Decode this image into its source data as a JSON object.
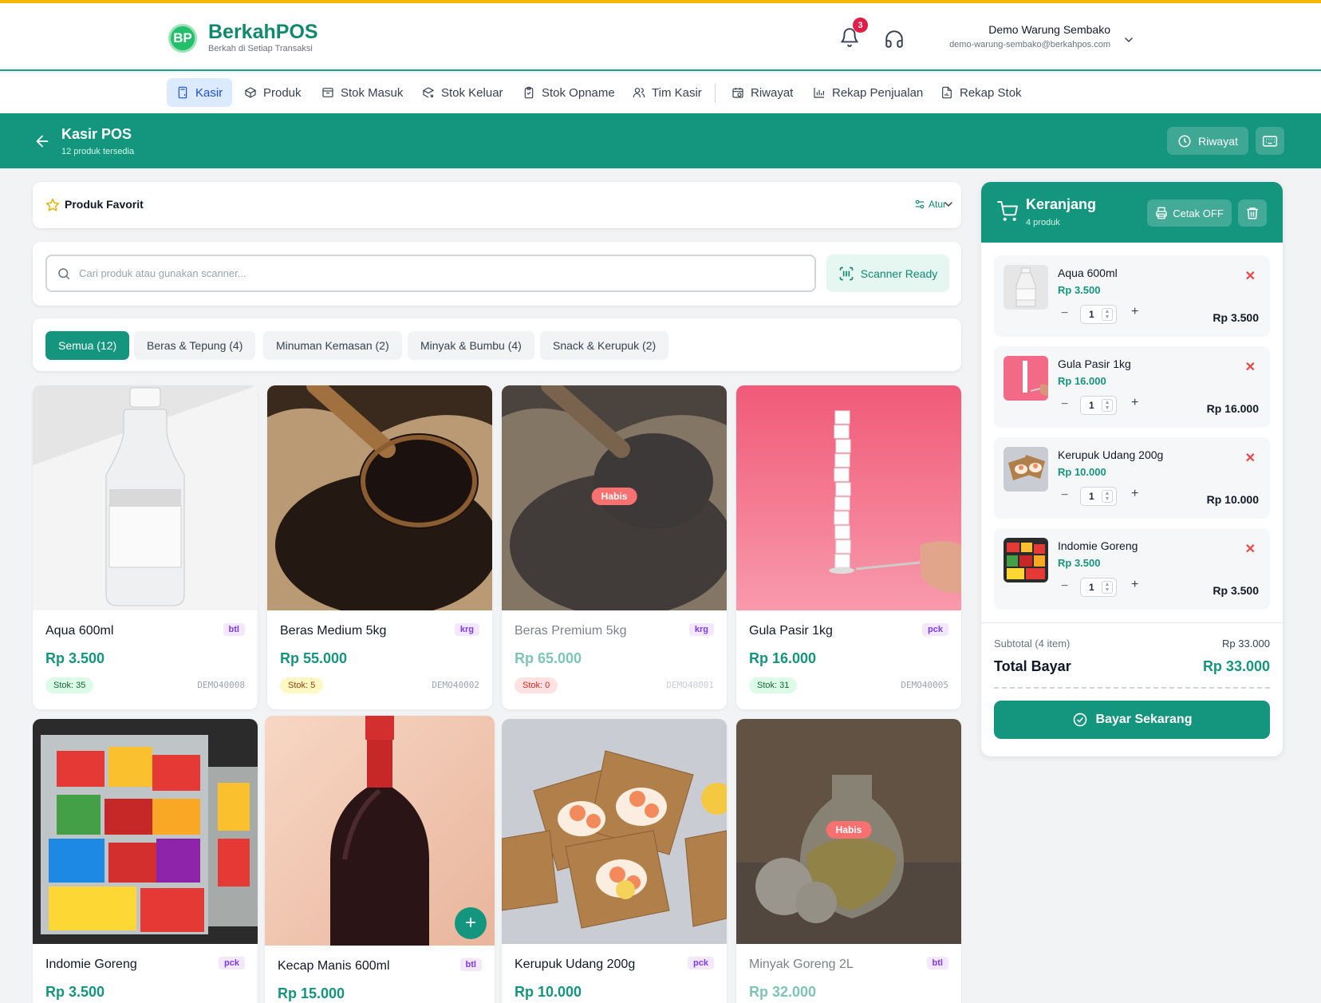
{
  "brand": {
    "name": "BerkahPOS",
    "tagline": "Berkah di Setiap Transaksi",
    "logo_text": "BP"
  },
  "notifications": {
    "count": "3"
  },
  "user": {
    "name": "Demo Warung Sembako",
    "email": "demo-warung-sembako@berkahpos.com"
  },
  "nav": [
    {
      "label": "Kasir",
      "icon": "calculator-icon",
      "active": true
    },
    {
      "label": "Produk",
      "icon": "box-icon"
    },
    {
      "label": "Stok Masuk",
      "icon": "inbox-icon"
    },
    {
      "label": "Stok Keluar",
      "icon": "package-out-icon"
    },
    {
      "label": "Stok Opname",
      "icon": "clipboard-icon"
    },
    {
      "label": "Tim Kasir",
      "icon": "users-icon"
    },
    {
      "label": "Riwayat",
      "icon": "calendar-clock-icon"
    },
    {
      "label": "Rekap Penjualan",
      "icon": "bar-chart-icon"
    },
    {
      "label": "Rekap Stok",
      "icon": "file-chart-icon"
    }
  ],
  "page": {
    "title": "Kasir POS",
    "subtitle": "12 produk tersedia",
    "riwayat_label": "Riwayat"
  },
  "favorites": {
    "title": "Produk Favorit",
    "atur_label": "Atur"
  },
  "search": {
    "placeholder": "Cari produk atau gunakan scanner...",
    "scanner_label": "Scanner Ready"
  },
  "categories": [
    {
      "label": "Semua (12)",
      "active": true
    },
    {
      "label": "Beras & Tepung (4)"
    },
    {
      "label": "Minuman Kemasan (2)"
    },
    {
      "label": "Minyak & Bumbu (4)"
    },
    {
      "label": "Snack & Kerupuk (2)"
    }
  ],
  "products": [
    {
      "name": "Aqua 600ml",
      "unit": "btl",
      "price": "Rp 3.500",
      "stock": "Stok: 35",
      "code": "DEMO40008"
    },
    {
      "name": "Beras Medium 5kg",
      "unit": "krg",
      "price": "Rp 55.000",
      "stock": "Stok: 5",
      "code": "DEMO40002"
    },
    {
      "name": "Beras Premium 5kg",
      "unit": "krg",
      "price": "Rp 65.000",
      "stock": "Stok: 0",
      "code": "DEMO40001",
      "badge": "Habis"
    },
    {
      "name": "Gula Pasir 1kg",
      "unit": "pck",
      "price": "Rp 16.000",
      "stock": "Stok: 31",
      "code": "DEMO40005"
    },
    {
      "name": "Indomie Goreng",
      "unit": "pck",
      "price": "Rp 3.500"
    },
    {
      "name": "Kecap Manis 600ml",
      "unit": "btl",
      "price": "Rp 15.000"
    },
    {
      "name": "Kerupuk Udang 200g",
      "unit": "pck",
      "price": "Rp 10.000"
    },
    {
      "name": "Minyak Goreng 2L",
      "unit": "btl",
      "price": "Rp 32.000",
      "badge": "Habis"
    }
  ],
  "cart": {
    "title": "Keranjang",
    "subtitle": "4 produk",
    "print_label": "Cetak OFF",
    "items": [
      {
        "name": "Aqua 600ml",
        "price": "Rp 3.500",
        "qty": "1",
        "total": "Rp 3.500"
      },
      {
        "name": "Gula Pasir 1kg",
        "price": "Rp 16.000",
        "qty": "1",
        "total": "Rp 16.000"
      },
      {
        "name": "Kerupuk Udang 200g",
        "price": "Rp 10.000",
        "qty": "1",
        "total": "Rp 10.000"
      },
      {
        "name": "Indomie Goreng",
        "price": "Rp 3.500",
        "qty": "1",
        "total": "Rp 3.500"
      }
    ],
    "subtotal_label": "Subtotal (4 item)",
    "subtotal_value": "Rp 33.000",
    "total_label": "Total Bayar",
    "total_value": "Rp 33.000",
    "pay_label": "Bayar Sekarang"
  },
  "colors": {
    "primary": "#14957e",
    "accent_stripe": "#f5b800",
    "danger": "#ef4444"
  }
}
